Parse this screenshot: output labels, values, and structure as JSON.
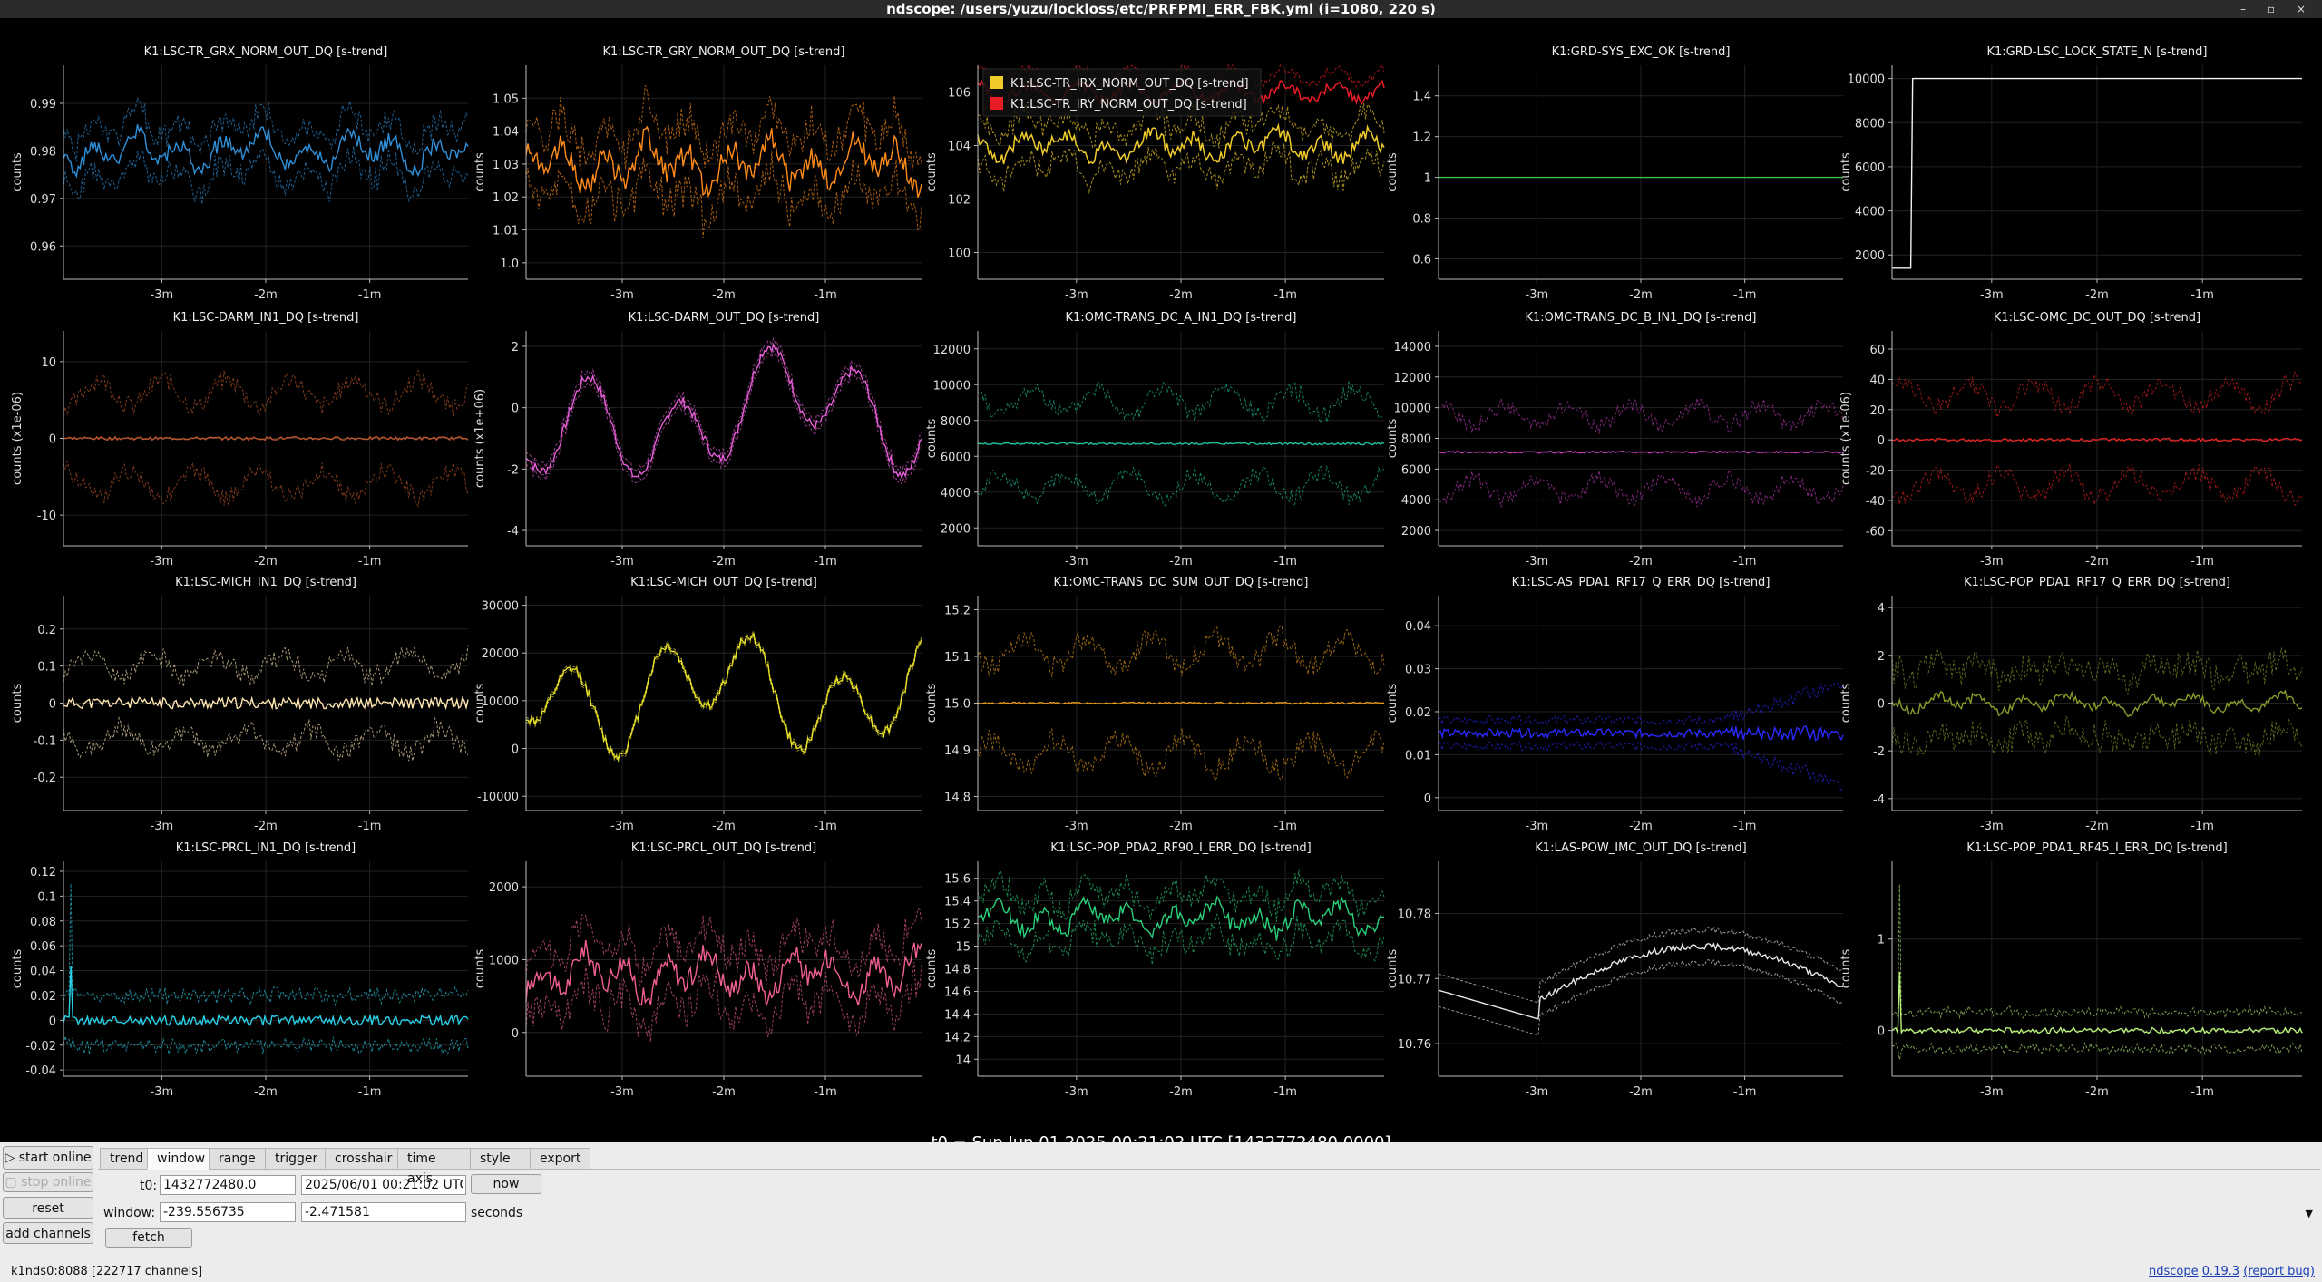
{
  "window": {
    "title": "ndscope: /users/yuzu/lockloss/etc/PRFPMI_ERR_FBK.yml (i=1080, 220 s)",
    "controls": "– ▫ ×"
  },
  "x_tick_labels": [
    "-3m",
    "-2m",
    "-1m"
  ],
  "t0_label": "t0 = Sun Jun 01 2025 00:21:02 UTC [1432772480.0000]",
  "plots": [
    {
      "title": "K1:LSC-TR_GRX_NORM_OUT_DQ [s-trend]",
      "ylabel": "counts",
      "color": "#2f8fd8",
      "ylim": [
        0.953,
        0.998
      ],
      "yticks": [
        "0.96",
        "0.97",
        "0.98",
        "0.99"
      ],
      "ytick_values": [
        0.96,
        0.97,
        0.98,
        0.99
      ],
      "mode": "band",
      "center": 0.98,
      "amp": 0.004,
      "band": 0.006,
      "seed": 1
    },
    {
      "title": "K1:LSC-TR_GRY_NORM_OUT_DQ [s-trend]",
      "ylabel": "counts",
      "color": "#ff8c1a",
      "ylim": [
        0.995,
        1.06
      ],
      "yticks": [
        "1.0",
        "1.01",
        "1.02",
        "1.03",
        "1.04",
        "1.05"
      ],
      "ytick_values": [
        1.0,
        1.01,
        1.02,
        1.03,
        1.04,
        1.05
      ],
      "mode": "band",
      "center": 1.03,
      "amp": 0.008,
      "band": 0.012,
      "seed": 2
    },
    {
      "title": "",
      "ylabel": "counts",
      "color": "#f0cc2a",
      "color2": "#e81c24",
      "ylim": [
        99,
        107
      ],
      "yticks": [
        "100",
        "102",
        "104",
        "106"
      ],
      "ytick_values": [
        100,
        102,
        104,
        106
      ],
      "mode": "dual",
      "center": 104,
      "center2": 106,
      "amp": 0.6,
      "band": 1.0,
      "seed": 3,
      "legend": [
        "K1:LSC-TR_IRX_NORM_OUT_DQ [s-trend]",
        "K1:LSC-TR_IRY_NORM_OUT_DQ [s-trend]"
      ]
    },
    {
      "title": "K1:GRD-SYS_EXC_OK [s-trend]",
      "ylabel": "counts",
      "color": "#3fbf3f",
      "ylim": [
        0.5,
        1.55
      ],
      "yticks": [
        "0.6",
        "0.8",
        "1",
        "1.2",
        "1.4"
      ],
      "ytick_values": [
        0.6,
        0.8,
        1,
        1.2,
        1.4
      ],
      "mode": "flat",
      "center": 1,
      "seed": 4
    },
    {
      "title": "K1:GRD-LSC_LOCK_STATE_N [s-trend]",
      "ylabel": "counts",
      "color": "#f0f0f0",
      "ylim": [
        900,
        10600
      ],
      "yticks": [
        "2000",
        "4000",
        "6000",
        "8000",
        "10000"
      ],
      "ytick_values": [
        2000,
        4000,
        6000,
        8000,
        10000
      ],
      "mode": "step",
      "low": 1400,
      "high": 10000,
      "seed": 5
    },
    {
      "title": "K1:LSC-DARM_IN1_DQ [s-trend]",
      "ylabel": "counts (x1e-06)",
      "color": "#c0562a",
      "ylim": [
        -14,
        14
      ],
      "yticks": [
        "-10",
        "0",
        "10"
      ],
      "ytick_values": [
        -10,
        0,
        10
      ],
      "mode": "envelope",
      "center": 0,
      "amp": 0.2,
      "band": 7,
      "seed": 6
    },
    {
      "title": "K1:LSC-DARM_OUT_DQ [s-trend]",
      "ylabel": "counts (x1e+06)",
      "color": "#e65ed8",
      "ylim": [
        -4.5,
        2.5
      ],
      "yticks": [
        "-4",
        "-2",
        "0",
        "2"
      ],
      "ytick_values": [
        -4,
        -2,
        0,
        2
      ],
      "mode": "smooth",
      "center": 0,
      "amp": 2.2,
      "band": 0.2,
      "seed": 7
    },
    {
      "title": "K1:OMC-TRANS_DC_A_IN1_DQ [s-trend]",
      "ylabel": "counts",
      "color": "#1fc29a",
      "ylim": [
        1000,
        13000
      ],
      "yticks": [
        "2000",
        "4000",
        "6000",
        "8000",
        "10000",
        "12000"
      ],
      "ytick_values": [
        2000,
        4000,
        6000,
        8000,
        10000,
        12000
      ],
      "mode": "envelope",
      "center": 6700,
      "amp": 60,
      "band": 2800,
      "seed": 8
    },
    {
      "title": "K1:OMC-TRANS_DC_B_IN1_DQ [s-trend]",
      "ylabel": "counts",
      "color": "#c03ab8",
      "ylim": [
        1000,
        15000
      ],
      "yticks": [
        "2000",
        "4000",
        "6000",
        "8000",
        "10000",
        "12000",
        "14000"
      ],
      "ytick_values": [
        2000,
        4000,
        6000,
        8000,
        10000,
        12000,
        14000
      ],
      "mode": "envelope",
      "center": 7100,
      "amp": 60,
      "band": 2800,
      "seed": 9
    },
    {
      "title": "K1:LSC-OMC_DC_OUT_DQ [s-trend]",
      "ylabel": "counts (x1e-06)",
      "color": "#e02424",
      "ylim": [
        -70,
        72
      ],
      "yticks": [
        "-60",
        "-40",
        "-20",
        "0",
        "20",
        "40",
        "60"
      ],
      "ytick_values": [
        -60,
        -40,
        -20,
        0,
        20,
        40,
        60
      ],
      "mode": "envelope",
      "center": 0,
      "amp": 1,
      "band": 35,
      "seed": 10
    },
    {
      "title": "K1:LSC-MICH_IN1_DQ [s-trend]",
      "ylabel": "counts",
      "color": "#ffe6b0",
      "ylim": [
        -0.29,
        0.29
      ],
      "yticks": [
        "-0.2",
        "-0.1",
        "0",
        "0.1",
        "0.2"
      ],
      "ytick_values": [
        -0.2,
        -0.1,
        0,
        0.1,
        0.2
      ],
      "mode": "envelope",
      "center": 0,
      "amp": 0.015,
      "band": 0.12,
      "seed": 11
    },
    {
      "title": "K1:LSC-MICH_OUT_DQ [s-trend]",
      "ylabel": "counts",
      "color": "#e8e02a",
      "ylim": [
        -13000,
        32000
      ],
      "yticks": [
        "-10000",
        "0",
        "10000",
        "20000",
        "30000"
      ],
      "ytick_values": [
        -10000,
        0,
        10000,
        20000,
        30000
      ],
      "mode": "smooth",
      "center": 12000,
      "amp": 14000,
      "band": 500,
      "seed": 12
    },
    {
      "title": "K1:OMC-TRANS_DC_SUM_OUT_DQ [s-trend]",
      "ylabel": "counts",
      "color": "#e69a1a",
      "ylim": [
        14.77,
        15.23
      ],
      "yticks": [
        "14.8",
        "14.9",
        "15.0",
        "15.1",
        "15.2"
      ],
      "ytick_values": [
        14.8,
        14.9,
        15.0,
        15.1,
        15.2
      ],
      "mode": "envelope",
      "center": 15.0,
      "amp": 0.002,
      "band": 0.13,
      "seed": 13
    },
    {
      "title": "K1:LSC-AS_PDA1_RF17_Q_ERR_DQ [s-trend]",
      "ylabel": "counts",
      "color": "#2a2aff",
      "ylim": [
        -0.003,
        0.047
      ],
      "yticks": [
        "0",
        "0.01",
        "0.02",
        "0.03",
        "0.04"
      ],
      "ytick_values": [
        0,
        0.01,
        0.02,
        0.03,
        0.04
      ],
      "mode": "grow",
      "center": 0.015,
      "amp": 0.001,
      "band": 0.003,
      "seed": 14
    },
    {
      "title": "K1:LSC-POP_PDA1_RF17_Q_ERR_DQ [s-trend]",
      "ylabel": "counts",
      "color": "#8a9a2a",
      "ylim": [
        -4.5,
        4.5
      ],
      "yticks": [
        "-4",
        "-2",
        "0",
        "2",
        "4"
      ],
      "ytick_values": [
        -4,
        -2,
        0,
        2,
        4
      ],
      "mode": "band",
      "center": 0,
      "amp": 0.4,
      "band": 1.8,
      "seed": 15
    },
    {
      "title": "K1:LSC-PRCL_IN1_DQ [s-trend]",
      "ylabel": "counts",
      "color": "#2ad0e8",
      "ylim": [
        -0.045,
        0.128
      ],
      "yticks": [
        "-0.04",
        "-0.02",
        "0",
        "0.02",
        "0.04",
        "0.06",
        "0.08",
        "0.1",
        "0.12"
      ],
      "ytick_values": [
        -0.04,
        -0.02,
        0,
        0.02,
        0.04,
        0.06,
        0.08,
        0.1,
        0.12
      ],
      "mode": "spike",
      "center": 0,
      "amp": 0.004,
      "band": 0.02,
      "spike": 0.11,
      "seed": 16
    },
    {
      "title": "K1:LSC-PRCL_OUT_DQ [s-trend]",
      "ylabel": "counts",
      "color": "#f06090",
      "ylim": [
        -600,
        2350
      ],
      "yticks": [
        "0",
        "1000",
        "2000"
      ],
      "ytick_values": [
        0,
        1000,
        2000
      ],
      "mode": "band",
      "center": 800,
      "amp": 350,
      "band": 500,
      "seed": 17
    },
    {
      "title": "K1:LSC-POP_PDA2_RF90_I_ERR_DQ [s-trend]",
      "ylabel": "counts",
      "color": "#2ad07a",
      "ylim": [
        13.85,
        15.75
      ],
      "yticks": [
        "14",
        "14.2",
        "14.4",
        "14.6",
        "14.8",
        "15",
        "15.2",
        "15.4",
        "15.6"
      ],
      "ytick_values": [
        14,
        14.2,
        14.4,
        14.6,
        14.8,
        15,
        15.2,
        15.4,
        15.6
      ],
      "mode": "band",
      "center": 15.25,
      "amp": 0.15,
      "band": 0.25,
      "seed": 18
    },
    {
      "title": "K1:LAS-POW_IMC_OUT_DQ [s-trend]",
      "ylabel": "counts",
      "color": "#e8e8e8",
      "ylim": [
        10.755,
        10.788
      ],
      "yticks": [
        "10.76",
        "10.77",
        "10.78"
      ],
      "ytick_values": [
        10.76,
        10.77,
        10.78
      ],
      "mode": "hump",
      "center": 10.77,
      "amp": 0.009,
      "band": 0.0025,
      "seed": 19
    },
    {
      "title": "K1:LSC-POP_PDA1_RF45_I_ERR_DQ [s-trend]",
      "ylabel": "counts",
      "color": "#b8f07a",
      "ylim": [
        -0.5,
        1.85
      ],
      "yticks": [
        "0",
        "1"
      ],
      "ytick_values": [
        0,
        1
      ],
      "mode": "spike",
      "center": 0,
      "amp": 0.03,
      "band": 0.2,
      "spike": 1.6,
      "seed": 20
    }
  ],
  "tabs": [
    "trend",
    "window",
    "range",
    "trigger",
    "crosshair",
    "time axis",
    "style",
    "export"
  ],
  "active_tab": "window",
  "buttons": {
    "start_online": "start online",
    "stop_online": "stop online",
    "reset": "reset",
    "add_channels": "add channels",
    "now": "now",
    "fetch": "fetch"
  },
  "window_tab": {
    "t0_label": "t0:",
    "t0_gps": "1432772480.0",
    "t0_utc": "2025/06/01 00:21:02 UTC",
    "window_label": "window:",
    "window_start": "-239.556735",
    "window_end": "-2.471581",
    "seconds_label": "seconds"
  },
  "status": {
    "server": "k1nds0:8088 [222717 channels]",
    "app_name": "ndscope",
    "version": "0.19.3",
    "report_bug": "(report bug)"
  }
}
